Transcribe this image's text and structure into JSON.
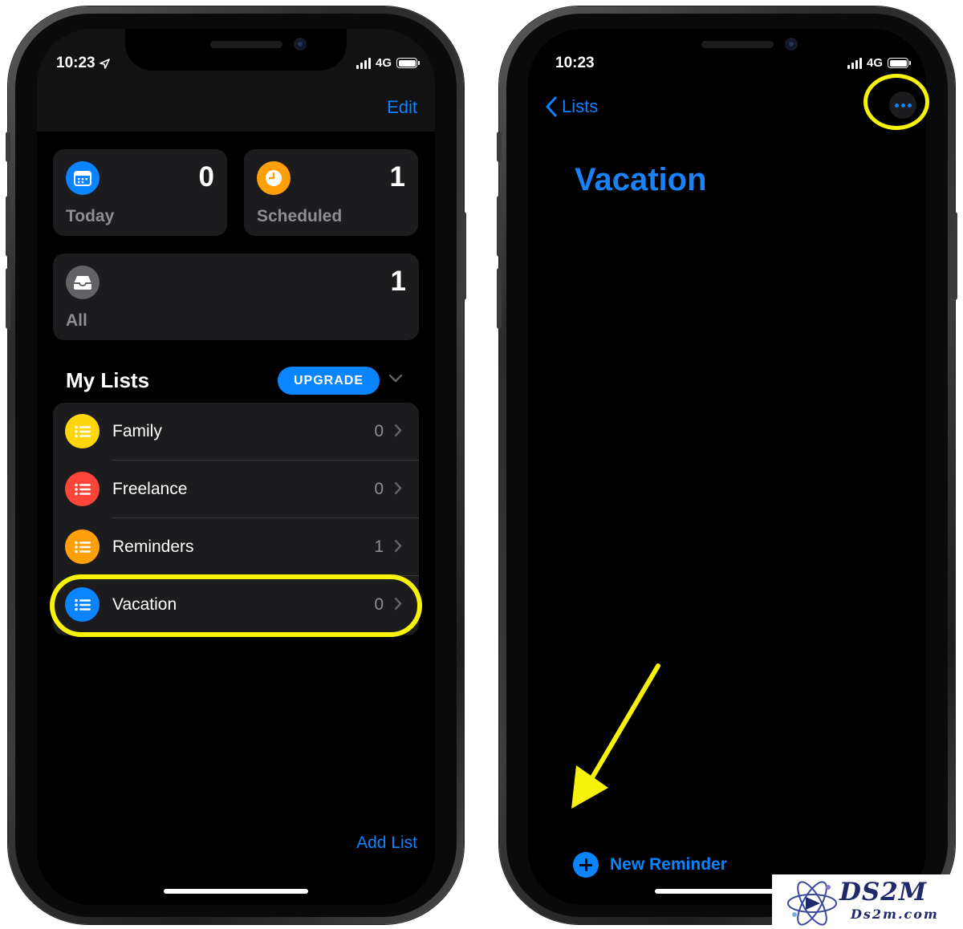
{
  "status_left": {
    "time": "10:23",
    "network": "4G"
  },
  "status_right": {
    "time": "10:23",
    "network": "4G"
  },
  "lists_screen": {
    "edit_label": "Edit",
    "smart_lists": [
      {
        "label": "Today",
        "count": "0",
        "icon": "calendar-icon",
        "color": "#0a84ff"
      },
      {
        "label": "Scheduled",
        "count": "1",
        "icon": "clock-icon",
        "color": "#ff9f0a"
      },
      {
        "label": "All",
        "count": "1",
        "icon": "tray-icon",
        "color": "#636366"
      }
    ],
    "section_title": "My Lists",
    "upgrade_label": "UPGRADE",
    "lists": [
      {
        "name": "Family",
        "count": "0",
        "color": "#ffd60a"
      },
      {
        "name": "Freelance",
        "count": "0",
        "color": "#ff453a"
      },
      {
        "name": "Reminders",
        "count": "1",
        "color": "#ff9f0a"
      },
      {
        "name": "Vacation",
        "count": "0",
        "color": "#0a84ff"
      }
    ],
    "add_list_label": "Add List"
  },
  "detail_screen": {
    "back_label": "Lists",
    "title": "Vacation",
    "new_reminder_label": "New Reminder"
  },
  "watermark": {
    "title": "DS2M",
    "subtitle": "Ds2m.com"
  },
  "colors": {
    "accent": "#0a84ff",
    "highlight": "#f7f20a",
    "card": "#1c1c1e"
  }
}
